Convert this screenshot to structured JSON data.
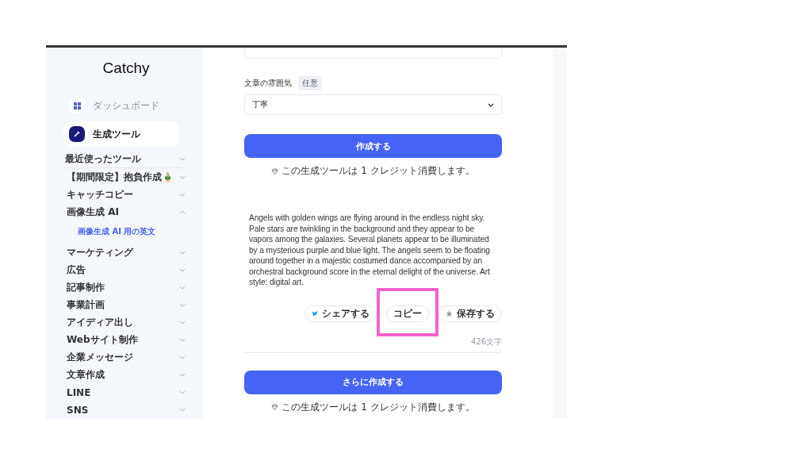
{
  "sidebar": {
    "logo": "Catchy",
    "nav": [
      {
        "label": "ダッシュボード",
        "kind": "dashboard",
        "selected": false
      },
      {
        "label": "生成ツール",
        "kind": "tools",
        "selected": true
      }
    ],
    "categories": [
      {
        "label": "最近使ったツール",
        "expanded": false
      },
      {
        "label": "【期間限定】抱負作成🎍",
        "expanded": false
      },
      {
        "label": "キャッチコピー",
        "expanded": false
      },
      {
        "label": "画像生成 AI",
        "expanded": true,
        "children": [
          {
            "label": "画像生成 AI 用の英文"
          }
        ]
      },
      {
        "label": "マーケティング",
        "expanded": false
      },
      {
        "label": "広告",
        "expanded": false
      },
      {
        "label": "記事制作",
        "expanded": false
      },
      {
        "label": "事業計画",
        "expanded": false
      },
      {
        "label": "アイディア出し",
        "expanded": false
      },
      {
        "label": "Webサイト制作",
        "expanded": false
      },
      {
        "label": "企業メッセージ",
        "expanded": false
      },
      {
        "label": "文章作成",
        "expanded": false
      },
      {
        "label": "LINE",
        "expanded": false
      },
      {
        "label": "SNS",
        "expanded": false
      }
    ]
  },
  "form": {
    "tone_label": "文章の雰囲気",
    "tone_badge": "任意",
    "tone_value": "丁寧",
    "submit": "作成する",
    "credit_note": "この生成ツールは 1 クレジット消費します。"
  },
  "result": {
    "text": " Angels with golden wings are flying around in the endless night sky. Pale stars are twinkling in the background and they appear to be vapors among the galaxies. Several planets appear to be illuminated by a mysterious purple and blue light. The angels seem to be floating around together in a majestic costumed dance accompanied by an orchestral background score in the eternal delight of the universe. Art style: digital art.",
    "actions": [
      {
        "label": "シェアする",
        "kind": "share"
      },
      {
        "label": "コピー",
        "kind": "copy",
        "highlighted": true
      },
      {
        "label": "保存する",
        "kind": "save"
      }
    ],
    "char_count": "426文字"
  },
  "more": {
    "button": "さらに作成する",
    "credit_note": "この生成ツールは 1 クレジット消費します。"
  }
}
